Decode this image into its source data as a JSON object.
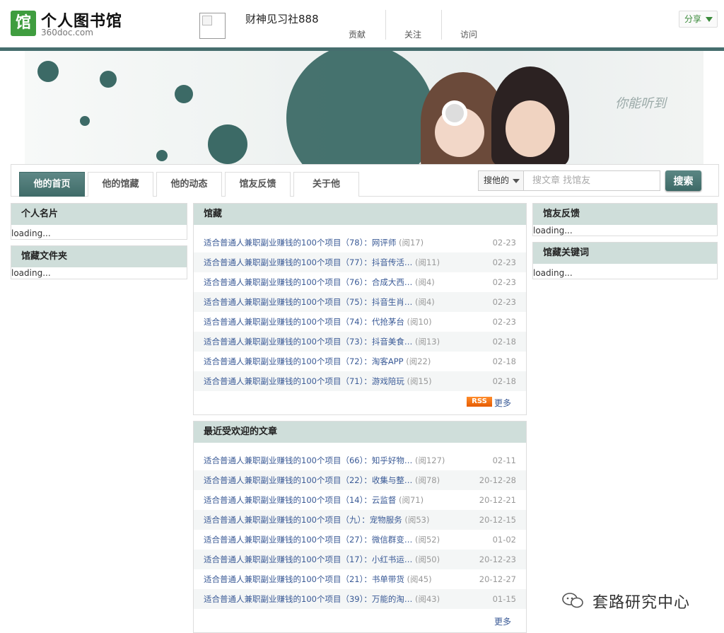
{
  "header": {
    "logo_glyph": "馆",
    "logo_title": "个人图书馆",
    "logo_sub": "360doc.com",
    "username": "财神见习社888",
    "stats": [
      "贡献",
      "关注",
      "访问"
    ],
    "share_label": "分享"
  },
  "banner": {
    "scribble": "你能听到"
  },
  "nav": {
    "tabs": [
      "他的首页",
      "他的馆藏",
      "他的动态",
      "馆友反馈",
      "关于他"
    ],
    "search_scope": "搜他的",
    "search_placeholder": "搜文章 找馆友",
    "search_button": "搜索"
  },
  "left": {
    "card_title": "个人名片",
    "card_loading": "loading...",
    "folder_title": "馆藏文件夹",
    "folder_loading": "loading..."
  },
  "right": {
    "feedback_title": "馆友反馈",
    "feedback_loading": "loading...",
    "keywords_title": "馆藏关键词",
    "keywords_loading": "loading..."
  },
  "collection": {
    "title": "馆藏",
    "rss": "RSS",
    "more": "更多",
    "items": [
      {
        "title": "适合普通人兼职副业赚钱的100个项目（78）：网评师",
        "reads": "(阅17)",
        "date": "02-23"
      },
      {
        "title": "适合普通人兼职副业赚钱的100个项目（77）：抖音传活…",
        "reads": "(阅11)",
        "date": "02-23"
      },
      {
        "title": "适合普通人兼职副业赚钱的100个项目（76）：合成大西…",
        "reads": "(阅4)",
        "date": "02-23"
      },
      {
        "title": "适合普通人兼职副业赚钱的100个项目（75）：抖音生肖…",
        "reads": "(阅4)",
        "date": "02-23"
      },
      {
        "title": "适合普通人兼职副业赚钱的100个项目（74）：代抢茅台",
        "reads": "(阅10)",
        "date": "02-23"
      },
      {
        "title": "适合普通人兼职副业赚钱的100个项目（73）：抖音美食…",
        "reads": "(阅13)",
        "date": "02-18"
      },
      {
        "title": "适合普通人兼职副业赚钱的100个项目（72）：淘客APP",
        "reads": "(阅22)",
        "date": "02-18"
      },
      {
        "title": "适合普通人兼职副业赚钱的100个项目（71）：游戏陪玩",
        "reads": "(阅15)",
        "date": "02-18"
      }
    ]
  },
  "popular": {
    "title": "最近受欢迎的文章",
    "more": "更多",
    "items": [
      {
        "title": "适合普通人兼职副业赚钱的100个项目（66）：知乎好物…",
        "reads": "(阅127)",
        "date": "02-11"
      },
      {
        "title": "适合普通人兼职副业赚钱的100个项目（22）：收集与整…",
        "reads": "(阅78)",
        "date": "20-12-28"
      },
      {
        "title": "适合普通人兼职副业赚钱的100个项目（14）：云监督",
        "reads": "(阅71)",
        "date": "20-12-21"
      },
      {
        "title": "适合普通人兼职副业赚钱的100个项目（九）：宠物服务",
        "reads": "(阅53)",
        "date": "20-12-15"
      },
      {
        "title": "适合普通人兼职副业赚钱的100个项目（27）：微信群变…",
        "reads": "(阅52)",
        "date": "01-02"
      },
      {
        "title": "适合普通人兼职副业赚钱的100个项目（17）：小红书运…",
        "reads": "(阅50)",
        "date": "20-12-23"
      },
      {
        "title": "适合普通人兼职副业赚钱的100个项目（21）：书单带货",
        "reads": "(阅45)",
        "date": "20-12-27"
      },
      {
        "title": "适合普通人兼职副业赚钱的100个项目（39）：万能的淘…",
        "reads": "(阅43)",
        "date": "01-15"
      }
    ]
  },
  "watermark": "套路研究中心"
}
